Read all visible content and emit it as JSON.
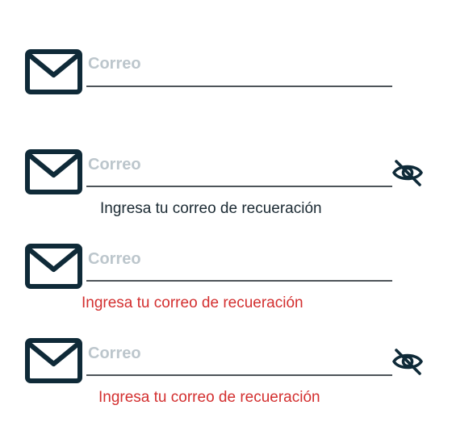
{
  "colors": {
    "icon": "#0f2a38",
    "placeholder": "#bcc6cc",
    "underline": "#4d5459",
    "helper_neutral": "#1b2a33",
    "error": "#d32f2f"
  },
  "fields": [
    {
      "icon": "mail-icon",
      "placeholder": "Correo",
      "helper": null,
      "show_visibility_toggle": false
    },
    {
      "icon": "mail-icon",
      "placeholder": "Correo",
      "helper": "Ingresa tu correo de recueración",
      "helper_state": "neutral",
      "show_visibility_toggle": true,
      "visibility_icon": "eye-off-icon"
    },
    {
      "icon": "mail-icon",
      "placeholder": "Correo",
      "helper": "Ingresa tu correo de recueración",
      "helper_state": "error",
      "show_visibility_toggle": false
    },
    {
      "icon": "mail-icon",
      "placeholder": "Correo",
      "helper": "Ingresa tu correo de recueración",
      "helper_state": "error",
      "show_visibility_toggle": true,
      "visibility_icon": "eye-off-icon"
    }
  ]
}
